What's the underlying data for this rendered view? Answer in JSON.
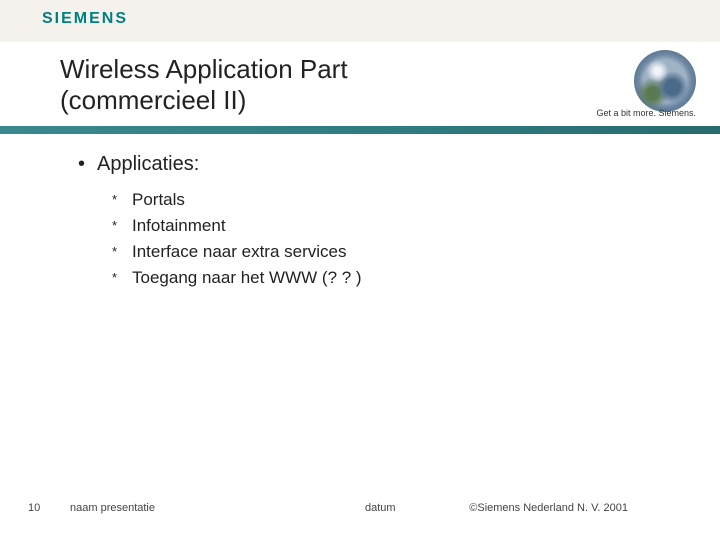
{
  "brand": {
    "logo_text": "SIEMENS",
    "tagline": "Get a bit more. Siemens."
  },
  "title": {
    "line1": "Wireless Application Part",
    "line2": "(commercieel II)"
  },
  "content": {
    "main_bullet": "Applicaties:",
    "subs": {
      "0": "Portals",
      "1": "Infotainment",
      "2": "Interface naar extra services",
      "3": "Toegang naar het WWW (? ? )"
    }
  },
  "footer": {
    "page_no": "10",
    "presentation_name": "naam presentatie",
    "date_placeholder": "datum",
    "copyright": "©Siemens Nederland N. V. 2001"
  }
}
